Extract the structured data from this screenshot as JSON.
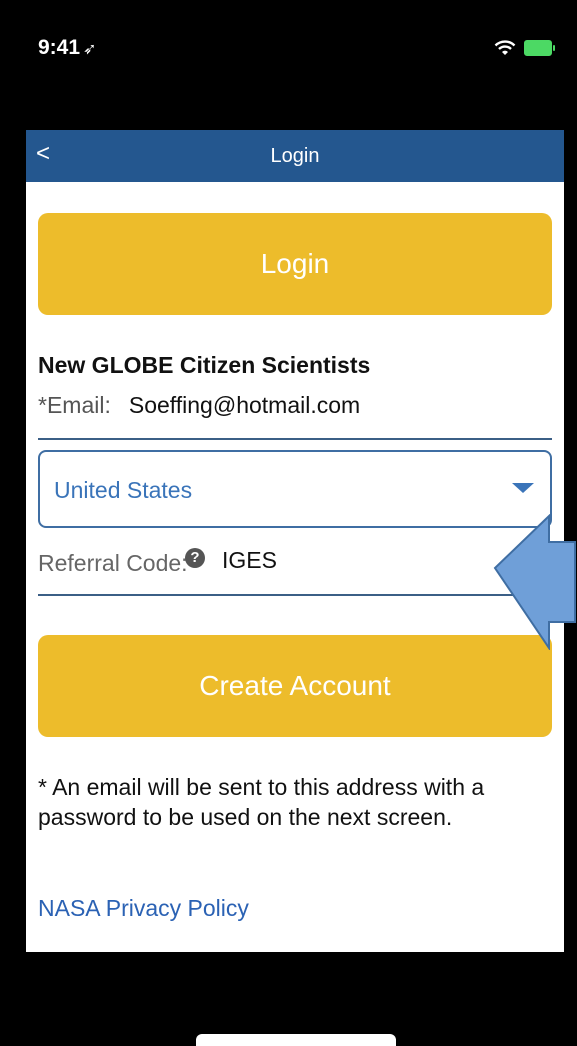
{
  "status_bar": {
    "time": "9:41",
    "location_glyph": "➶",
    "icons": [
      "location-arrow-icon",
      "wifi-icon",
      "battery-icon"
    ]
  },
  "nav": {
    "back_glyph": "<",
    "title": "Login"
  },
  "login_button": {
    "label": "Login"
  },
  "new_user_section": {
    "heading": "New GLOBE Citizen Scientists",
    "email_label": "*Email:",
    "email_value": "Soeffing@hotmail.com",
    "country_value": "United States",
    "referral_label": "Referral Code:",
    "referral_help_glyph": "?",
    "referral_value": "IGES"
  },
  "create_button": {
    "label": "Create Account"
  },
  "note": "* An email will be sent to this address with a password to be used on the next screen.",
  "privacy_link": "NASA Privacy Policy",
  "colors": {
    "nav_bar": "#24578f",
    "button": "#edbc2b",
    "link": "#2b62b4",
    "annotation_arrow": "#6f9fd8"
  }
}
